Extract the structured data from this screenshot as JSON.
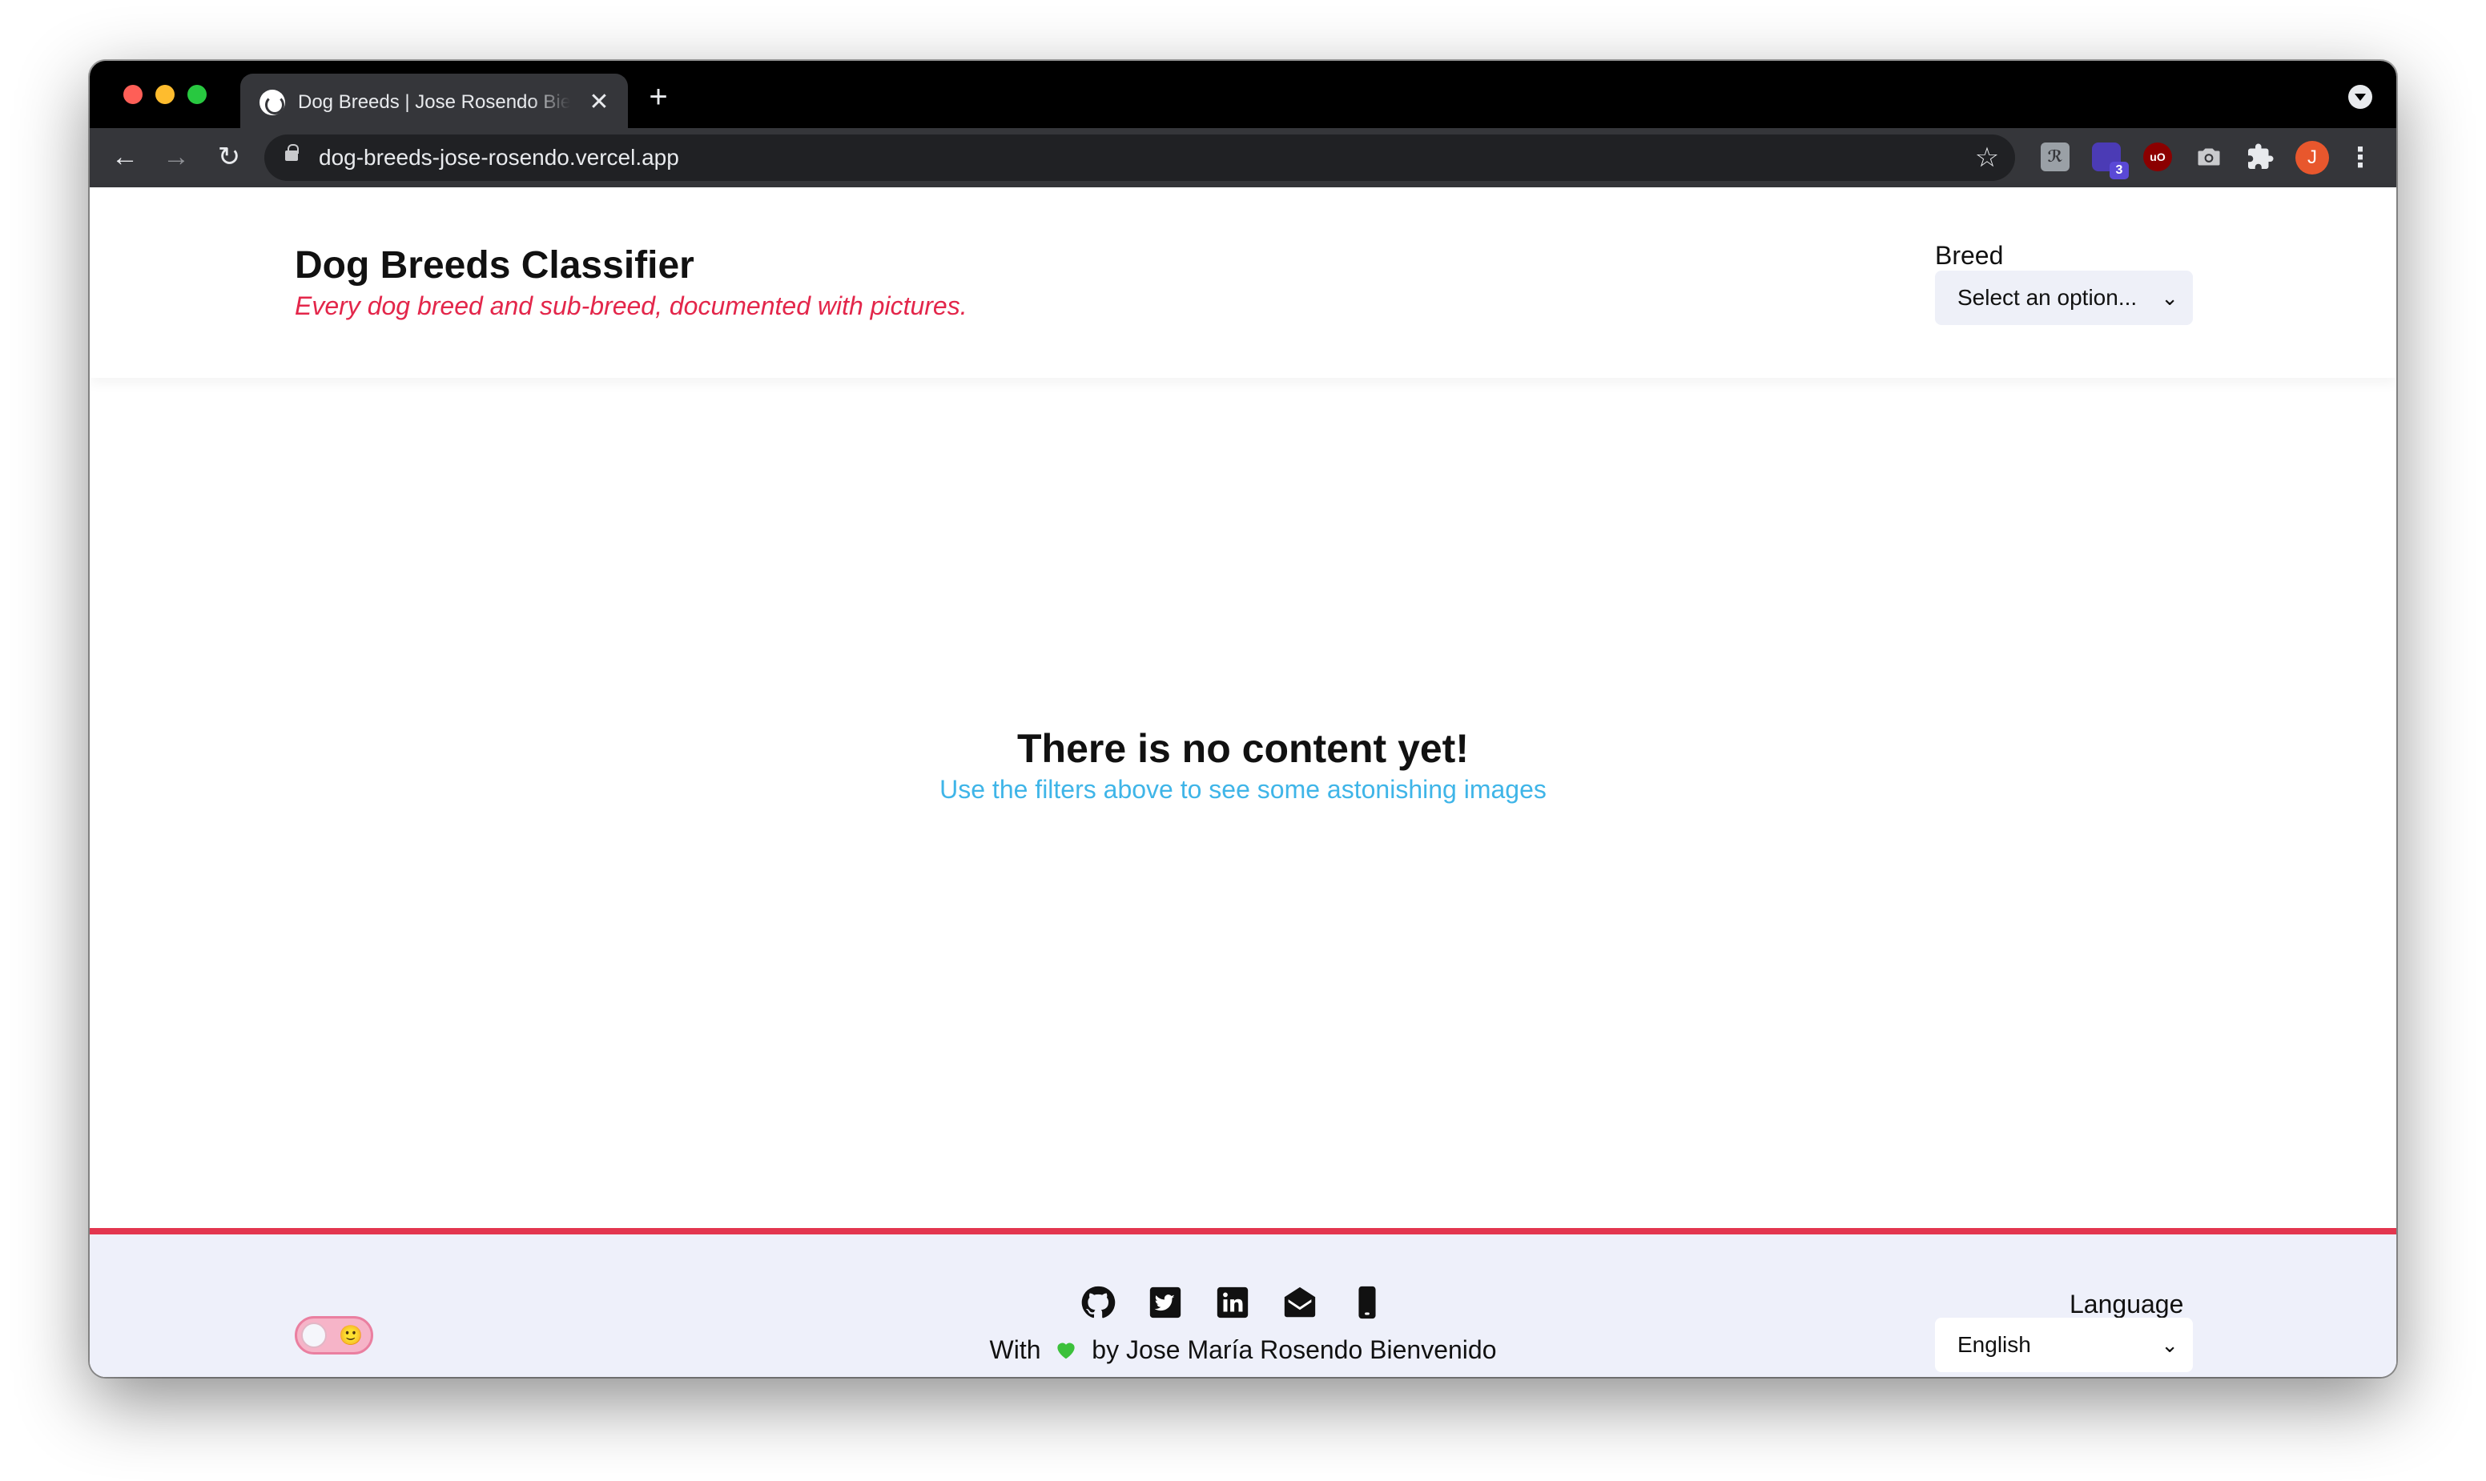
{
  "browser": {
    "tab": {
      "title": "Dog Breeds | Jose Rosendo Bienvenido",
      "close": "✕"
    },
    "new_tab": "+",
    "address_bar": {
      "url": "dog-breeds-jose-rosendo.vercel.app"
    },
    "nav": {
      "back": "←",
      "forward": "→",
      "reload": "↻"
    },
    "bookmark_icon": "☆",
    "extensions": {
      "ext1_label": "ℛ",
      "ext2_badge": "3",
      "ext3_label": "uO"
    },
    "profile_initial": "J",
    "menu": "⋮"
  },
  "header": {
    "title": "Dog Breeds Classifier",
    "subtitle": "Every dog breed and sub-breed, documented with pictures.",
    "breed_filter": {
      "label": "Breed",
      "selected": "Select an option..."
    }
  },
  "main": {
    "empty_title": "There is no content yet!",
    "empty_hint": "Use the filters above to see some astonishing images"
  },
  "footer": {
    "theme_toggle": {
      "state": "off",
      "emoji": "🙂"
    },
    "social_icons": [
      "github-icon",
      "twitter-icon",
      "linkedin-icon",
      "mail-icon",
      "phone-icon"
    ],
    "credit_before": "With",
    "credit_after": "by Jose María Rosendo Bienvenido",
    "language": {
      "label": "Language",
      "selected": "English"
    }
  },
  "colors": {
    "accent": "#e3264a",
    "link": "#3fb5e8",
    "footer_bg": "#eef0fa",
    "footer_border": "#e3364f",
    "heart": "#3cc13b"
  }
}
